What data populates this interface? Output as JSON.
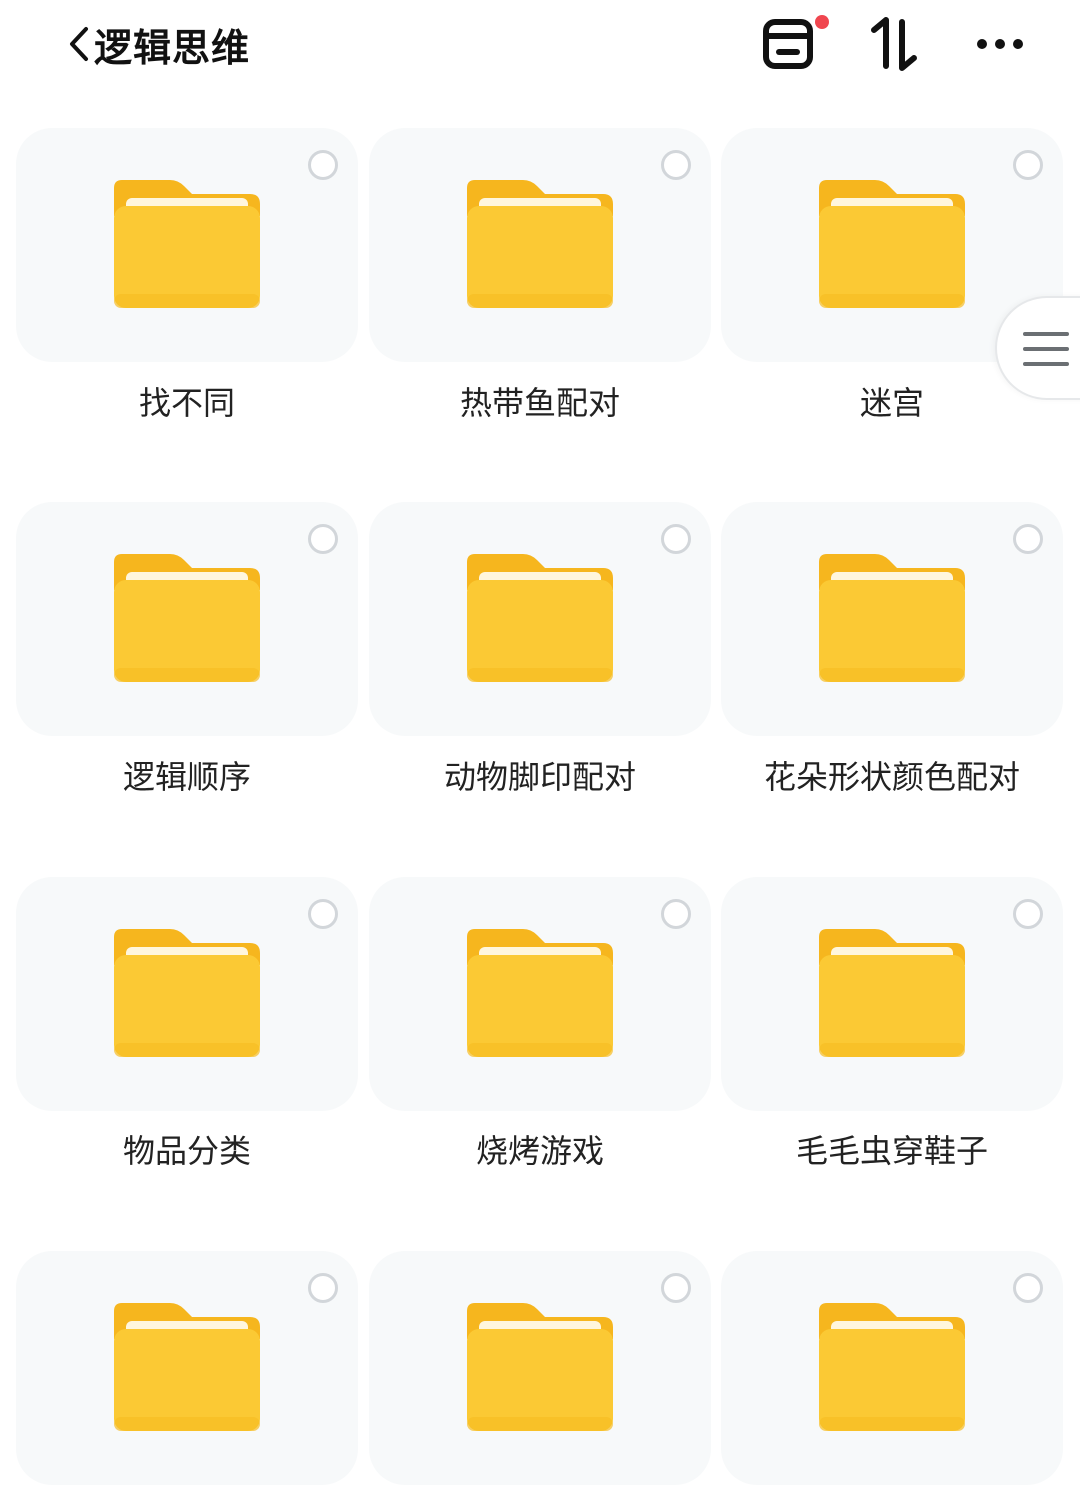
{
  "header": {
    "title": "逻辑思维",
    "back_icon": "chevron-left-icon",
    "recycle_icon": "recycle-bin-icon",
    "recycle_badge_color": "#f0464f",
    "sort_icon": "sort-arrows-icon",
    "more_icon": "more-horizontal-icon"
  },
  "folder_color": "#fbc934",
  "folders": [
    {
      "label": "找不同"
    },
    {
      "label": "热带鱼配对"
    },
    {
      "label": "迷宫"
    },
    {
      "label": "逻辑顺序"
    },
    {
      "label": "动物脚印配对"
    },
    {
      "label": "花朵形状颜色配对"
    },
    {
      "label": "物品分类"
    },
    {
      "label": "烧烤游戏"
    },
    {
      "label": "毛毛虫穿鞋子"
    },
    {
      "label": ""
    },
    {
      "label": ""
    },
    {
      "label": ""
    }
  ],
  "side_handle_icon": "menu-lines-icon"
}
